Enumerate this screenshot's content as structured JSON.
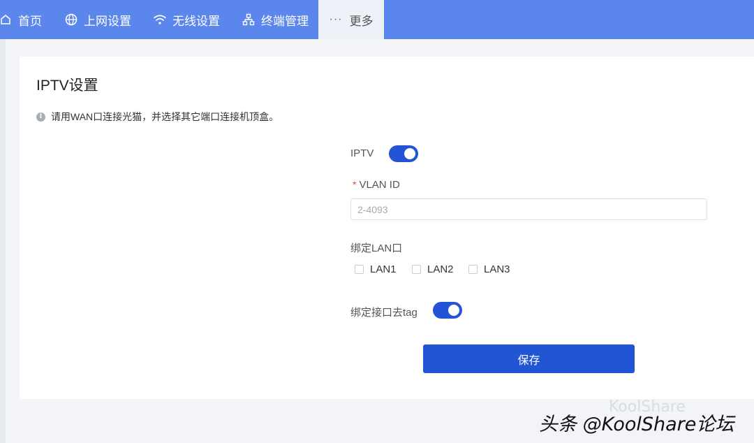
{
  "nav": {
    "items": [
      {
        "label": "首页",
        "icon": "home-icon"
      },
      {
        "label": "上网设置",
        "icon": "globe-icon"
      },
      {
        "label": "无线设置",
        "icon": "wifi-icon"
      },
      {
        "label": "终端管理",
        "icon": "network-icon"
      },
      {
        "label": "更多",
        "icon": "more-icon",
        "icon_glyph": "···",
        "active": true
      }
    ]
  },
  "page": {
    "title": "IPTV设置",
    "notice": "请用WAN口连接光猫，并选择其它端口连接机顶盒。"
  },
  "form": {
    "iptv_label": "IPTV",
    "iptv_enabled": true,
    "vlan_label": "VLAN ID",
    "vlan_required_mark": "*",
    "vlan_value": "",
    "vlan_placeholder": "2-4093",
    "bind_lan_label": "绑定LAN口",
    "lan_options": [
      {
        "label": "LAN1",
        "checked": false
      },
      {
        "label": "LAN2",
        "checked": false
      },
      {
        "label": "LAN3",
        "checked": false
      }
    ],
    "untag_label": "绑定接口去tag",
    "untag_enabled": true,
    "save_label": "保存"
  },
  "watermark": {
    "text": "头条 @KoolShare论坛",
    "ghost_text": "KoolShare"
  },
  "colors": {
    "nav_bg": "#5b87ec",
    "primary": "#2155d4",
    "required": "#e04a3f"
  }
}
